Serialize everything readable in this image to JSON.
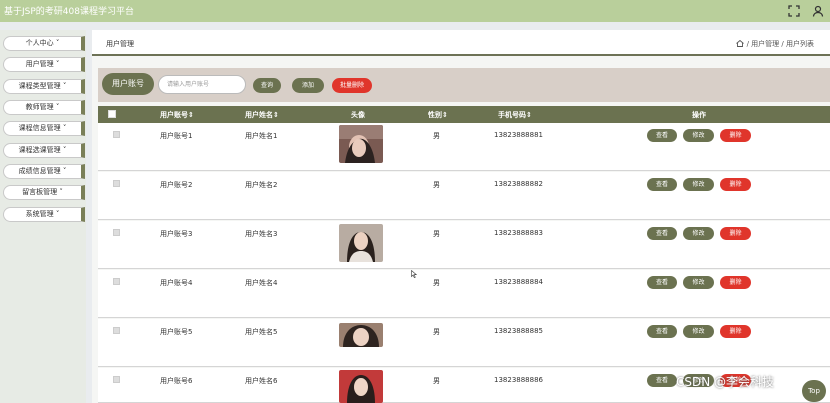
{
  "app": {
    "title": "基于JSP的考研408课程学习平台",
    "fullscreen_icon": "fullscreen-icon",
    "user_icon": "user-icon"
  },
  "sidebar": {
    "items": [
      {
        "label": "个人中心 ˅"
      },
      {
        "label": "用户管理 ˅"
      },
      {
        "label": "课程类型管理 ˅"
      },
      {
        "label": "教师管理 ˅"
      },
      {
        "label": "课程信息管理 ˅"
      },
      {
        "label": "课程选课管理 ˅"
      },
      {
        "label": "成绩信息管理 ˅"
      },
      {
        "label": "留言板管理 ˅"
      },
      {
        "label": "系统管理 ˅"
      }
    ]
  },
  "breadcrumb": {
    "title": "用户管理",
    "home_icon": "home-icon",
    "path": "/ 用户管理 / 用户列表"
  },
  "search": {
    "label": "用户账号",
    "placeholder": "请输入用户账号",
    "query_button": "查询",
    "add_button": "添加",
    "batch_delete_button": "批量删除"
  },
  "table": {
    "headers": {
      "account": "用户账号⇕",
      "name": "用户姓名⇕",
      "avatar": "头像",
      "gender": "性别⇕",
      "phone": "手机号码⇕",
      "actions": "操作"
    },
    "rows": [
      {
        "account": "用户账号1",
        "name": "用户姓名1",
        "gender": "男",
        "phone": "13823888881",
        "has_avatar": true
      },
      {
        "account": "用户账号2",
        "name": "用户姓名2",
        "gender": "男",
        "phone": "13823888882",
        "has_avatar": false
      },
      {
        "account": "用户账号3",
        "name": "用户姓名3",
        "gender": "男",
        "phone": "13823888883",
        "has_avatar": true
      },
      {
        "account": "用户账号4",
        "name": "用户姓名4",
        "gender": "男",
        "phone": "13823888884",
        "has_avatar": false
      },
      {
        "account": "用户账号5",
        "name": "用户姓名5",
        "gender": "男",
        "phone": "13823888885",
        "has_avatar": true
      },
      {
        "account": "用户账号6",
        "name": "用户姓名6",
        "gender": "男",
        "phone": "13823888886",
        "has_avatar": true
      }
    ],
    "row_actions": {
      "view": "查看",
      "edit": "修改",
      "delete": "删除"
    }
  },
  "watermark": "CSDN @李会科技",
  "back_to_top": "Top",
  "colors": {
    "topbar": "#b9cf9b",
    "accent": "#6b7250",
    "danger": "#e0352b",
    "search_panel": "#d8cfc8"
  }
}
